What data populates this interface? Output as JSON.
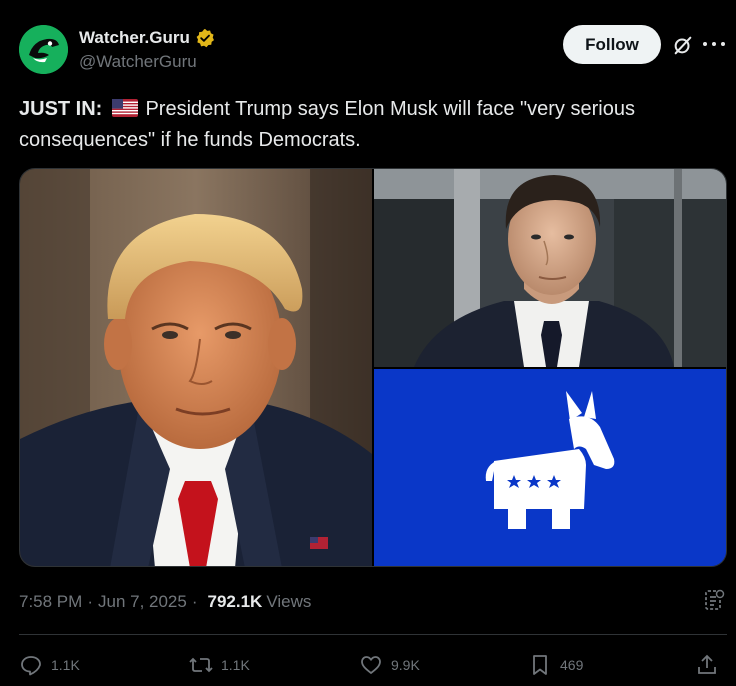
{
  "author": {
    "display_name": "Watcher.Guru",
    "handle": "@WatcherGuru",
    "verified_icon": "verified-badge-gold-icon",
    "avatar_icon": "watcher-guru-logo"
  },
  "header": {
    "follow_label": "Follow",
    "grok_icon": "grok-icon",
    "more_icon": "more-dots-icon"
  },
  "tweet": {
    "prefix": "JUST IN:",
    "flag_icon": "us-flag-icon",
    "text": "President Trump says Elon Musk will face \"very serious consequences\" if he funds Democrats."
  },
  "media": {
    "images": [
      "trump-portrait-image",
      "elon-musk-photo-image",
      "democratic-donkey-logo-image"
    ]
  },
  "meta": {
    "time": "7:58 PM",
    "separator": "·",
    "date": "Jun 7, 2025",
    "views_count": "792.1K",
    "views_label": "Views"
  },
  "actions": {
    "replies": "1.1K",
    "reposts": "1.1K",
    "likes": "9.9K",
    "bookmarks": "469"
  },
  "colors": {
    "background": "#000000",
    "text": "#e7e9ea",
    "secondary": "#71767b",
    "avatar_green": "#16b05c",
    "democrat_blue": "#0a37c8",
    "verified_gold": "#e2b719"
  }
}
